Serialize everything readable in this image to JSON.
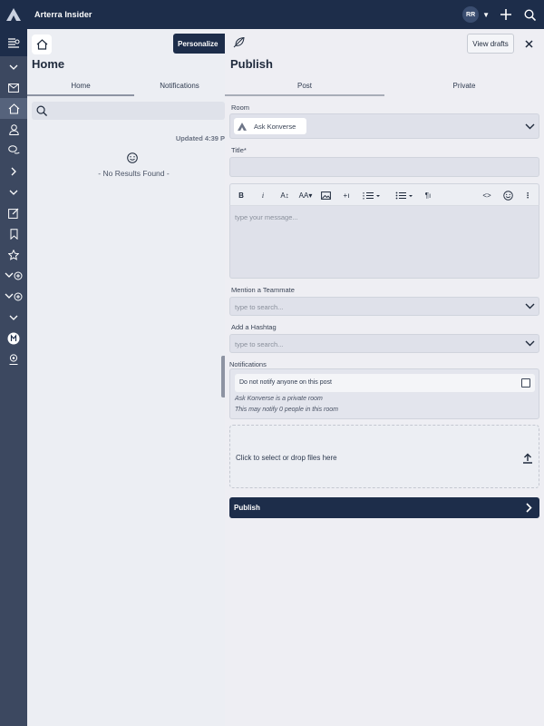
{
  "topbar": {
    "app_title": "Arterra Insider",
    "avatar_initials": "RR"
  },
  "home": {
    "title": "Home",
    "personalize_label": "Personalize",
    "tabs": [
      {
        "label": "Home"
      },
      {
        "label": "Notifications"
      }
    ],
    "updated_text": "Updated 4:39 P",
    "no_results": "- No Results Found -"
  },
  "publish": {
    "title": "Publish",
    "view_drafts_label": "View drafts",
    "tabs": [
      {
        "label": "Post"
      },
      {
        "label": "Private"
      }
    ],
    "room_label": "Room",
    "room_value": "Ask Konverse",
    "title_label": "Title*",
    "message_placeholder": "type your message...",
    "mention_label": "Mention a Teammate",
    "mention_placeholder": "type to search...",
    "hashtag_label": "Add a Hashtag",
    "hashtag_placeholder": "type to search...",
    "notifications_label": "Notifications",
    "notify_option": "Do not notify anyone on this post",
    "notify_note_1": "Ask Konverse is a private room",
    "notify_note_2": "This may notify 0 people in this room",
    "drop_text": "Click to select or drop files here",
    "publish_label": "Publish"
  },
  "colors": {
    "navy": "#1d2d4a",
    "rail": "#3c4860",
    "panel": "#eeeef3"
  }
}
